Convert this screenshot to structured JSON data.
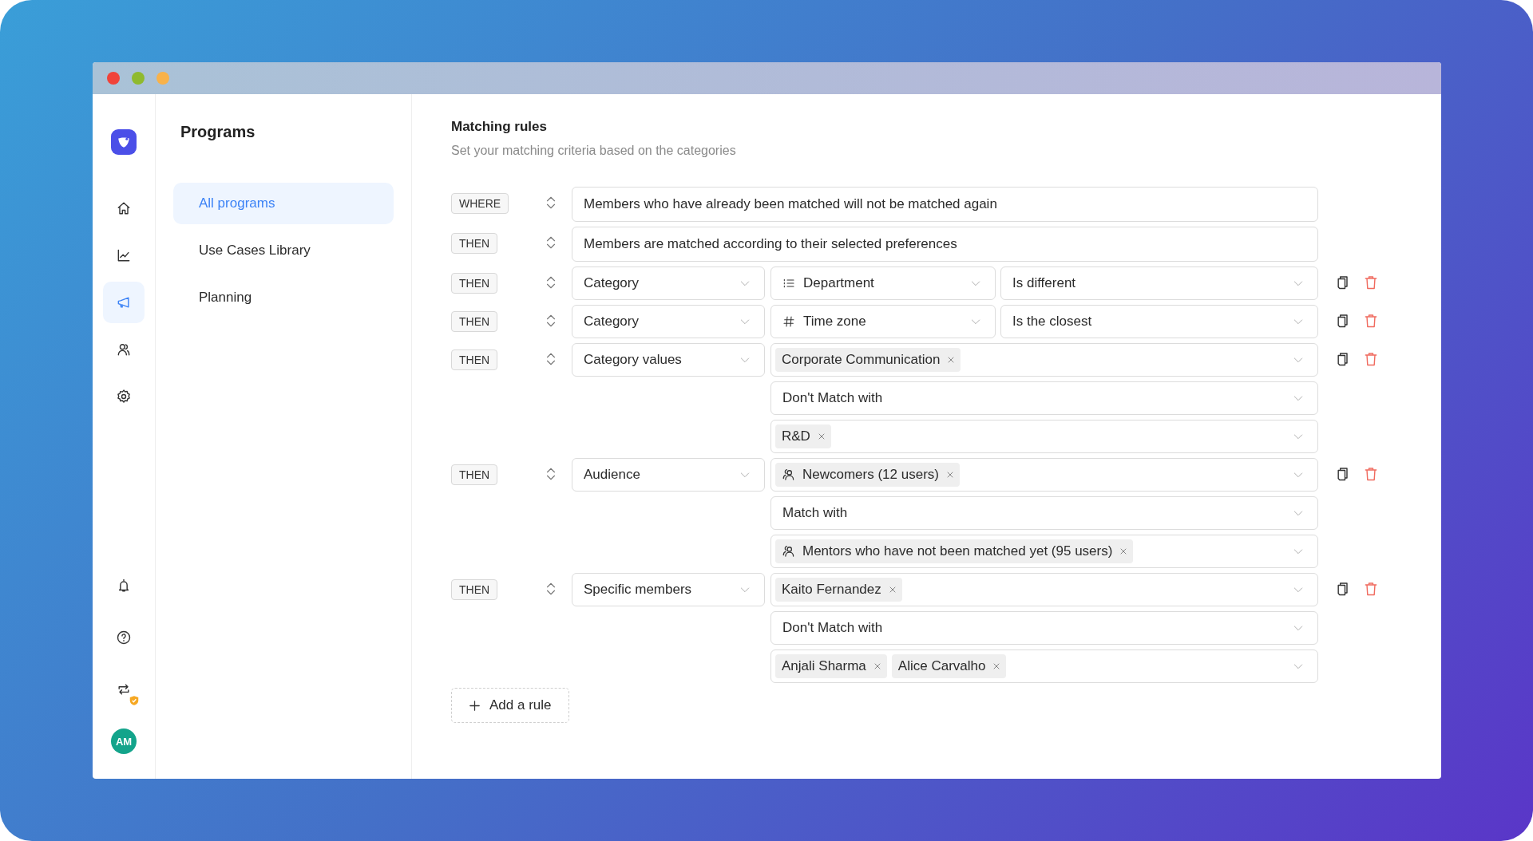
{
  "rail": {
    "items": [
      {
        "kind": "home",
        "selected": false
      },
      {
        "kind": "chart",
        "selected": false
      },
      {
        "kind": "megaphone",
        "selected": true
      },
      {
        "kind": "people",
        "selected": false
      },
      {
        "kind": "settings",
        "selected": false
      }
    ],
    "bottom_items": [
      {
        "kind": "bell",
        "badge": false
      },
      {
        "kind": "help",
        "badge": false
      },
      {
        "kind": "swap",
        "badge": true
      }
    ],
    "avatar": "AM"
  },
  "sidebar": {
    "title": "Programs",
    "items": [
      {
        "label": "All programs",
        "selected": true
      },
      {
        "label": "Use Cases Library",
        "selected": false
      },
      {
        "label": "Planning",
        "selected": false
      }
    ]
  },
  "main": {
    "title": "Matching rules",
    "subtitle": "Set your matching criteria based on the categories",
    "rules": [
      {
        "kind": "statement",
        "keyword": "WHERE",
        "text": "Members who have already been matched will not be matched again"
      },
      {
        "kind": "statement",
        "keyword": "THEN",
        "text": "Members are matched according to their selected preferences"
      },
      {
        "kind": "condition",
        "keyword": "THEN",
        "field": "Category",
        "attribute": {
          "kind": "list",
          "label": "Department"
        },
        "operator": "Is different"
      },
      {
        "kind": "condition",
        "keyword": "THEN",
        "field": "Category",
        "attribute": {
          "kind": "number",
          "label": "Time zone"
        },
        "operator": "Is the closest"
      },
      {
        "kind": "pairing",
        "keyword": "THEN",
        "field": "Category values",
        "source": [
          {
            "label": "Corporate Communication",
            "group": false
          }
        ],
        "relation": "Don't Match with",
        "target": [
          {
            "label": "R&D",
            "group": false
          }
        ]
      },
      {
        "kind": "pairing",
        "keyword": "THEN",
        "field": "Audience",
        "source": [
          {
            "label": "Newcomers (12 users)",
            "group": true
          }
        ],
        "relation": "Match with",
        "target": [
          {
            "label": "Mentors who have not been matched yet (95 users)",
            "group": true
          }
        ]
      },
      {
        "kind": "pairing",
        "keyword": "THEN",
        "field": "Specific members",
        "source": [
          {
            "label": "Kaito Fernandez",
            "group": false
          }
        ],
        "relation": "Don't Match with",
        "target": [
          {
            "label": "Anjali Sharma",
            "group": false
          },
          {
            "label": "Alice Carvalho",
            "group": false
          }
        ]
      }
    ],
    "add_button": "Add a rule"
  }
}
